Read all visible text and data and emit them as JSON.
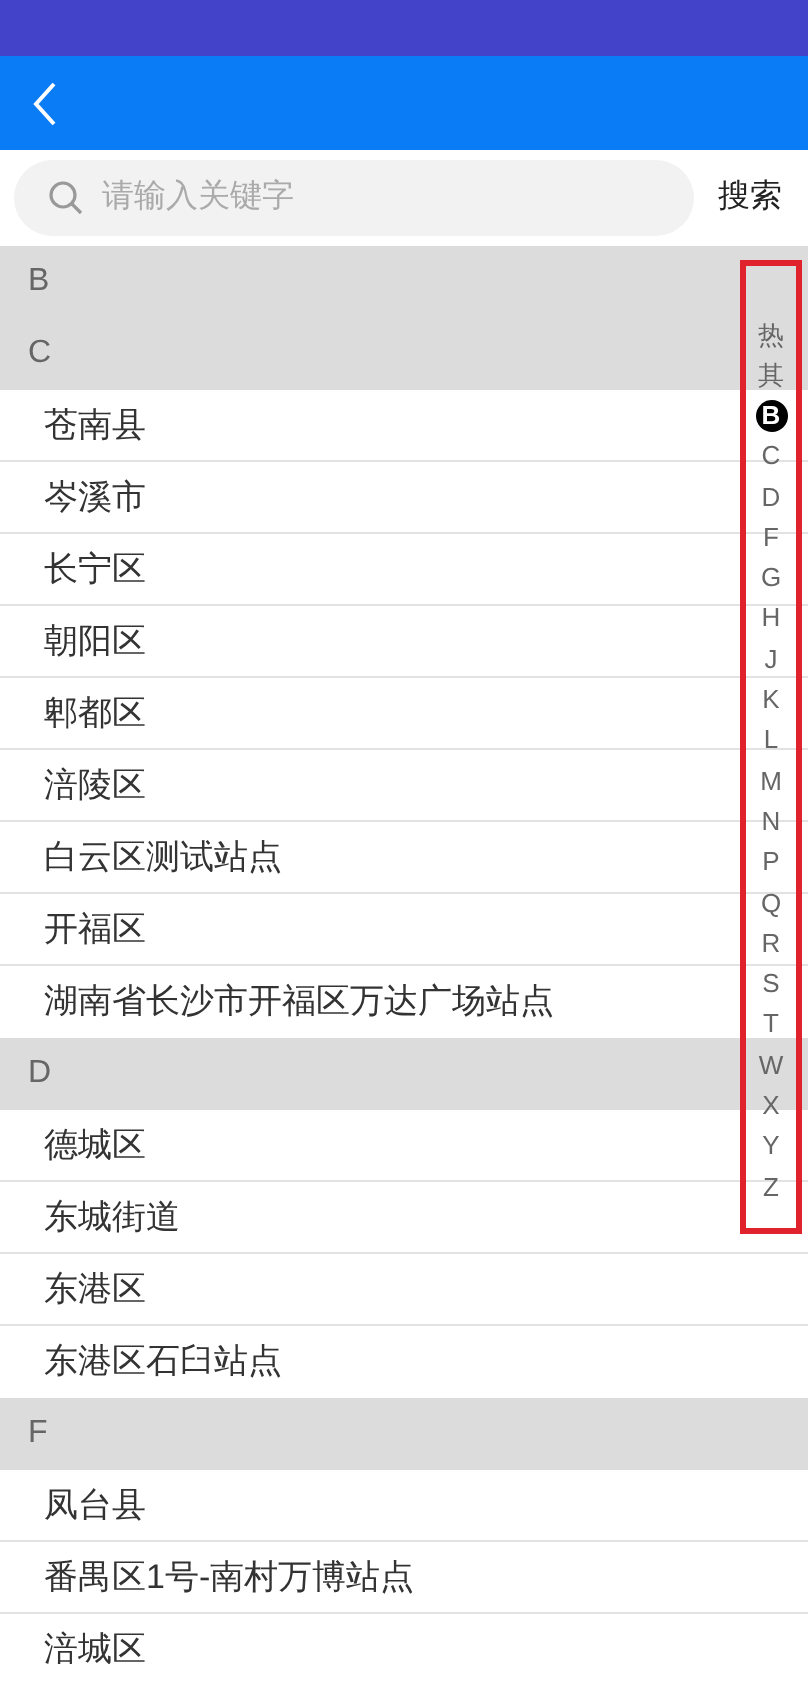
{
  "search": {
    "placeholder": "请输入关键字",
    "button": "搜索"
  },
  "sections": [
    {
      "letter": "B"
    },
    {
      "letter": "C",
      "items": [
        "苍南县",
        "岑溪市",
        "长宁区",
        "朝阳区",
        "郫都区",
        "涪陵区",
        "白云区测试站点",
        "开福区",
        "湖南省长沙市开福区万达广场站点"
      ]
    },
    {
      "letter": "D",
      "items": [
        "德城区",
        "东城街道",
        "东港区",
        "东港区石臼站点"
      ]
    },
    {
      "letter": "F",
      "items": [
        "凤台县",
        "番禺区1号-南村万博站点",
        "涪城区"
      ]
    }
  ],
  "index": [
    {
      "label": "热",
      "selected": false
    },
    {
      "label": "其",
      "selected": false
    },
    {
      "label": "B",
      "selected": true
    },
    {
      "label": "C",
      "selected": false
    },
    {
      "label": "D",
      "selected": false
    },
    {
      "label": "F",
      "selected": false
    },
    {
      "label": "G",
      "selected": false
    },
    {
      "label": "H",
      "selected": false
    },
    {
      "label": "J",
      "selected": false
    },
    {
      "label": "K",
      "selected": false
    },
    {
      "label": "L",
      "selected": false
    },
    {
      "label": "M",
      "selected": false
    },
    {
      "label": "N",
      "selected": false
    },
    {
      "label": "P",
      "selected": false
    },
    {
      "label": "Q",
      "selected": false
    },
    {
      "label": "R",
      "selected": false
    },
    {
      "label": "S",
      "selected": false
    },
    {
      "label": "T",
      "selected": false
    },
    {
      "label": "W",
      "selected": false
    },
    {
      "label": "X",
      "selected": false
    },
    {
      "label": "Y",
      "selected": false
    },
    {
      "label": "Z",
      "selected": false
    }
  ]
}
